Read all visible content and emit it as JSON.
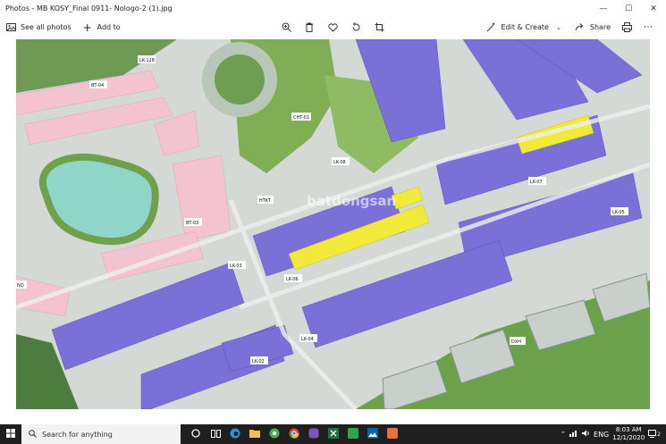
{
  "window": {
    "title": "Photos - MB KOSY_Final 0911- Nologo-2 (1).jpg",
    "minimize_glyph": "—",
    "maximize_glyph": "☐",
    "close_glyph": "✕"
  },
  "toolbar": {
    "see_all_photos": "See all photos",
    "add_to": "Add to",
    "edit_create": "Edit & Create",
    "share": "Share"
  },
  "map": {
    "watermark": "batdongsan",
    "labels": [
      "LK-128",
      "BT-04",
      "CHT-01",
      "LK-08",
      "HTKT",
      "BT-03",
      "LK-03",
      "LK-06",
      "LK-07",
      "LK-05",
      "LK-04",
      "LK-02",
      "DXH",
      "NO"
    ]
  },
  "taskbar": {
    "search_placeholder": "Search for anything",
    "language": "ENG",
    "time": "8:03 AM",
    "date": "12/1/2020",
    "notification_count": "2"
  },
  "colors": {
    "purple_lots": "#7b6fd6",
    "pink_lots": "#f3c3d0",
    "yellow_lots": "#f1ea3a",
    "park_green": "#6fa04c",
    "water": "#8ed3c4",
    "road": "#d2d6d4"
  }
}
